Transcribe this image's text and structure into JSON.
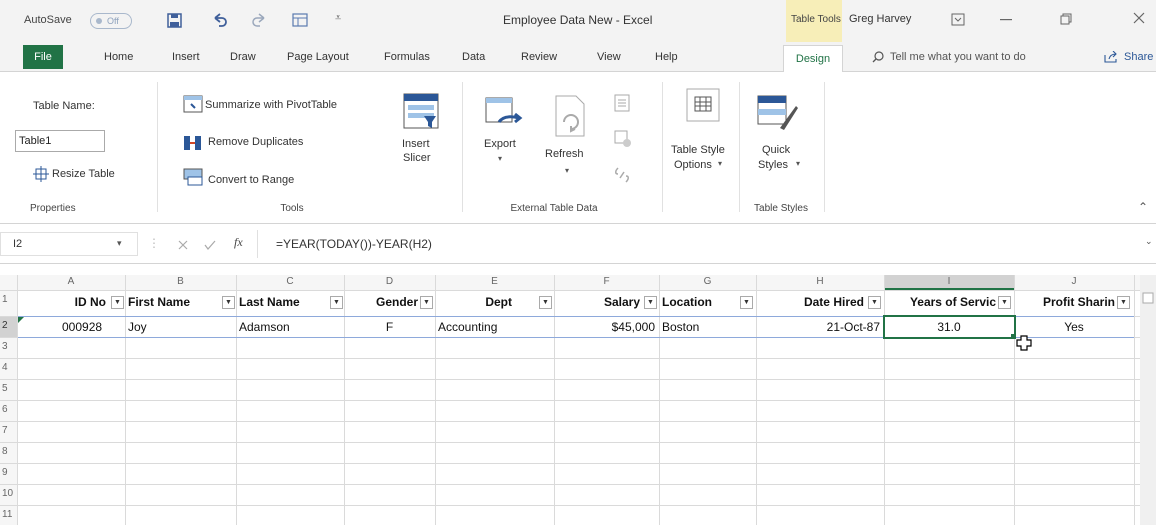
{
  "titlebar": {
    "autosave_label": "AutoSave",
    "autosave_state": "Off",
    "doc_title": "Employee Data New - Excel",
    "context_label": "Table Tools",
    "user_name": "Greg Harvey"
  },
  "tabs": {
    "file": "File",
    "home": "Home",
    "insert": "Insert",
    "draw": "Draw",
    "page_layout": "Page Layout",
    "formulas": "Formulas",
    "data": "Data",
    "review": "Review",
    "view": "View",
    "help": "Help",
    "design": "Design",
    "tell_me": "Tell me what you want to do",
    "share": "Share"
  },
  "ribbon": {
    "table_name_label": "Table Name:",
    "table_name_value": "Table1",
    "resize_table": "Resize Table",
    "properties_group": "Properties",
    "summarize_pivot": "Summarize with PivotTable",
    "remove_duplicates": "Remove Duplicates",
    "convert_to_range": "Convert to Range",
    "tools_group": "Tools",
    "insert_slicer_l1": "Insert",
    "insert_slicer_l2": "Slicer",
    "export": "Export",
    "refresh": "Refresh",
    "external_group": "External Table Data",
    "style_options_l1": "Table Style",
    "style_options_l2": "Options",
    "quick_styles_l1": "Quick",
    "quick_styles_l2": "Styles",
    "table_styles_group": "Table Styles"
  },
  "formula_bar": {
    "name_box": "I2",
    "fx": "fx",
    "formula": "=YEAR(TODAY())-YEAR(H2)"
  },
  "sheet": {
    "columns": [
      "A",
      "B",
      "C",
      "D",
      "E",
      "F",
      "G",
      "H",
      "I",
      "J"
    ],
    "rows": [
      "1",
      "2",
      "3",
      "4",
      "5",
      "6",
      "7",
      "8",
      "9",
      "10",
      "11"
    ],
    "headers": [
      "ID No",
      "First Name",
      "Last Name",
      "Gender",
      "Dept",
      "Salary",
      "Location",
      "Date Hired",
      "Years of Servic",
      "Profit Sharin"
    ],
    "data_row": [
      "000928",
      "Joy",
      "Adamson",
      "F",
      "Accounting",
      "$45,000",
      "Boston",
      "21-Oct-87",
      "31.0",
      "Yes"
    ]
  }
}
